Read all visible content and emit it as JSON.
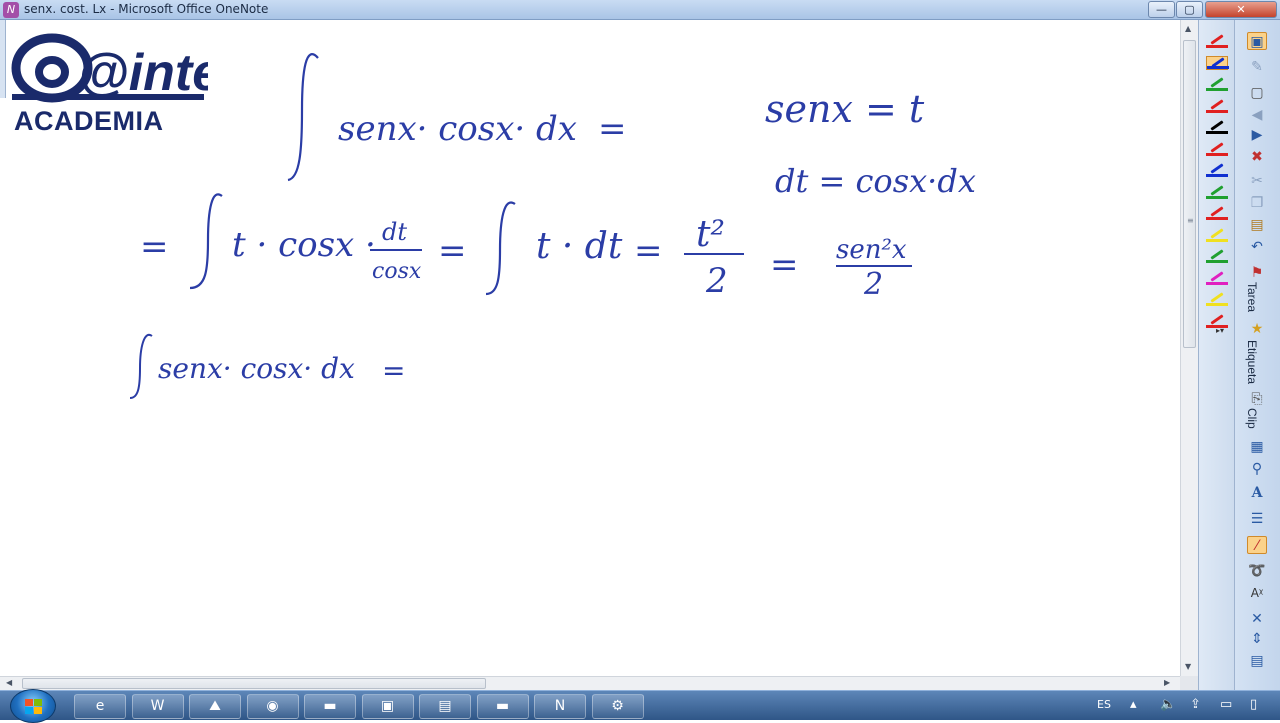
{
  "window": {
    "title": "senx. cost. Lx - Microsoft Office OneNote",
    "buttons": {
      "minimize": "—",
      "maximize": "▢",
      "close": "✕"
    }
  },
  "logo": {
    "main": "@inte",
    "sub": "ACADEMIA"
  },
  "notes": {
    "line1": {
      "integrand": "senx· cosx· dx",
      "equals": "="
    },
    "substitution": {
      "eq1": "senx = t",
      "eq2": "dt = cosx·dx"
    },
    "line2": {
      "eq_start": "=",
      "term1": "t · cosx ·",
      "frac1_num": "dt",
      "frac1_den": "cosx",
      "eq2": "=",
      "term2": "t · dt",
      "eq3": "=",
      "frac2_num": "t²",
      "frac2_den": "2",
      "eq4": "=",
      "frac3_num": "sen²x",
      "frac3_den": "2"
    },
    "line3": {
      "integrand": "senx· cosx· dx",
      "equals": "="
    }
  },
  "toolbar": {
    "pen_colors": [
      "#e02020",
      "#1030d0",
      "#20a030",
      "#e02020",
      "#000000",
      "#e02020",
      "#1030d0",
      "#20a030",
      "#e02020",
      "#f0e020",
      "#20a030",
      "#e020c0",
      "#f0e020",
      "#e02020"
    ],
    "selected_pen_index": 1,
    "labels": {
      "task": "Tarea",
      "tag": "Etiqueta",
      "clip": "Clip"
    }
  },
  "taskbar": {
    "language": "ES",
    "apps": [
      "ie-icon",
      "word-icon",
      "picture-icon",
      "firefox-icon",
      "folder-icon",
      "screen-icon",
      "notepad-icon",
      "folder-icon",
      "onenote-icon",
      "tool-icon"
    ]
  }
}
